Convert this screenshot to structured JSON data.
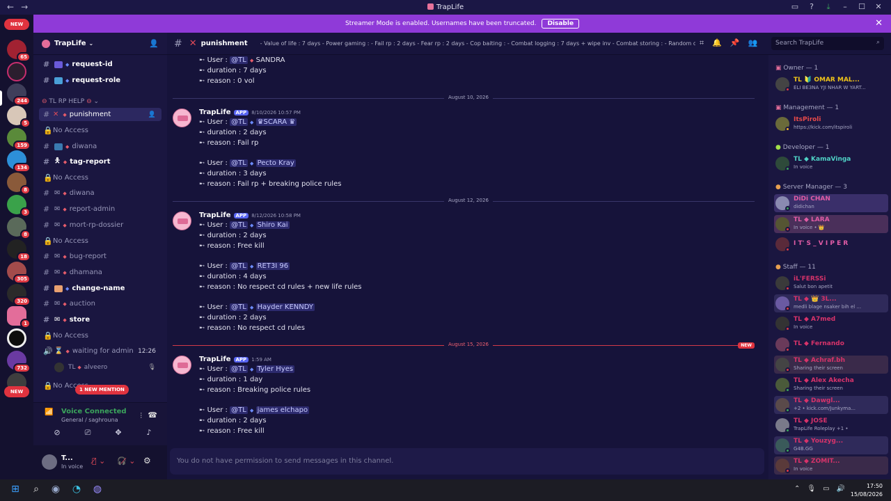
{
  "window": {
    "title": "TrapLife"
  },
  "banner": {
    "text": "Streamer Mode is enabled. Usernames have been truncated.",
    "button": "Disable"
  },
  "servers": {
    "new_top": "NEW",
    "new_bottom": "NEW",
    "badges": [
      "65",
      "244",
      "5",
      "159",
      "134",
      "8",
      "3",
      "8",
      "18",
      "305",
      "320",
      "1",
      "732"
    ]
  },
  "sidebar": {
    "server_name": "TrapLife",
    "category": "TL RP HELP",
    "new_mention": "1 NEW MENTION",
    "channels": [
      {
        "name": "request-id"
      },
      {
        "name": "request-role"
      },
      {
        "name": "punishment"
      },
      {
        "name": "No Access"
      },
      {
        "name": "diwana"
      },
      {
        "name": "tag-report"
      },
      {
        "name": "No Access"
      },
      {
        "name": "diwana"
      },
      {
        "name": "report-admin"
      },
      {
        "name": "mort-rp-dossier"
      },
      {
        "name": "No Access"
      },
      {
        "name": "bug-report"
      },
      {
        "name": "dhamana"
      },
      {
        "name": "change-name"
      },
      {
        "name": "auction"
      },
      {
        "name": "store"
      },
      {
        "name": "No Access"
      },
      {
        "name": "waiting for admin",
        "time": "12:26"
      },
      {
        "name": "No Access"
      }
    ],
    "voice_user": {
      "prefix": "TL",
      "name": "alveero"
    }
  },
  "voice": {
    "status": "Voice Connected",
    "location": "General / saghrouna"
  },
  "user": {
    "name": "T...",
    "status": "In voice"
  },
  "channel": {
    "name": "punishment",
    "topic": "- Value of life : 7 days - Power gaming : - Fail rp : 2 days - Fear rp : 2 days - Cop baiting : - Combat logging : 7 days + wipe inv - Combat storing : - Random dea...",
    "search_placeholder": "Search TrapLife",
    "composer_placeholder": "You do not have permission to send messages in this channel."
  },
  "labels": {
    "user": "User",
    "duration": "duration",
    "reason": "reason",
    "mention": "@TL",
    "app": "APP",
    "author": "TrapLife",
    "newtag": "NEW"
  },
  "messages": {
    "top": {
      "user": "SANDRA",
      "duration": "7 days",
      "reason": "0 vol"
    },
    "d1": "August 10, 2026",
    "m1": {
      "time": "8/10/2026 10:57 PM",
      "e1": {
        "user": "♛SCARA ♛",
        "duration": "2 days",
        "reason": "Fail rp"
      },
      "e2": {
        "user": "Pecto Kray",
        "duration": "3 days",
        "reason": "Fail rp + breaking police rules"
      }
    },
    "d2": "August 12, 2026",
    "m2": {
      "time": "8/12/2026 10:58 PM",
      "e1": {
        "user": "Shiro Kai",
        "duration": "2 days",
        "reason": "Free kill"
      },
      "e2": {
        "user": "RET3I 96",
        "duration": "4 days",
        "reason": "No respect cd rules + new life rules"
      },
      "e3": {
        "user": "Hayder KENNDY",
        "duration": "2  days",
        "reason": "No respect cd rules"
      }
    },
    "d3": "August 15, 2026",
    "m3": {
      "time": "1:59 AM",
      "e1": {
        "user": "Tyler Hyes",
        "duration": "1 day",
        "reason": "Breaking police rules"
      },
      "e2": {
        "user": "james elchapo",
        "duration": "2 days",
        "reason": "Free kill"
      }
    }
  },
  "members": {
    "groups": {
      "owner": "Owner — 1",
      "management": "Management — 1",
      "developer": "Developer — 1",
      "server_manager": "Server Manager — 3",
      "staff": "Staff — 11"
    },
    "list": [
      {
        "name": "TL 🔰 OMAR MAL...",
        "status": "ELI BE3NA YJI NHAR W YART...",
        "color": "#f0c419"
      },
      {
        "name": "ItsPiroli",
        "status": "https://kick.com/itspiroli",
        "color": "#e84a4a"
      },
      {
        "name": "TL ◆ KamaVinga",
        "status": "In voice",
        "color": "#4fd1c5"
      },
      {
        "name": "DiDi CHAN",
        "status": "didichan",
        "color": "#e25ca6"
      },
      {
        "name": "TL ◆ LARA",
        "status": "In voice • 👑",
        "color": "#e25ca6"
      },
      {
        "name": "I T' S _ V I P E R",
        "status": "",
        "color": "#e25ca6"
      },
      {
        "name": "iL'FERSSi",
        "status": "Salut bon apetit",
        "color": "#d8336a"
      },
      {
        "name": "TL ◆ 👑 3L...",
        "status": "medli blage nsaker bih el ...",
        "color": "#d8336a"
      },
      {
        "name": "TL ◆ A7med",
        "status": "In voice",
        "color": "#d8336a"
      },
      {
        "name": "TL ◆ Fernando",
        "status": "",
        "color": "#d8336a"
      },
      {
        "name": "TL ◆ Achraf.bh",
        "status": "Sharing their screen",
        "color": "#d8336a"
      },
      {
        "name": "TL ◆ Alex Akecha",
        "status": "Sharing their screen",
        "color": "#d8336a"
      },
      {
        "name": "TL ◆ Dawgl...",
        "status": "+2 • kick.com/Junkyma...",
        "color": "#d8336a"
      },
      {
        "name": "TL ◆ JOSE",
        "status": "TrapLife Roleplay +1 •",
        "color": "#d8336a"
      },
      {
        "name": "TL ◆ Youzyg...",
        "status": "G4B.GG",
        "color": "#d8336a"
      },
      {
        "name": "TL ◆ ZOMIT...",
        "status": "In voice",
        "color": "#d8336a"
      }
    ]
  },
  "taskbar": {
    "time": "17:50",
    "date": "15/08/2026"
  }
}
